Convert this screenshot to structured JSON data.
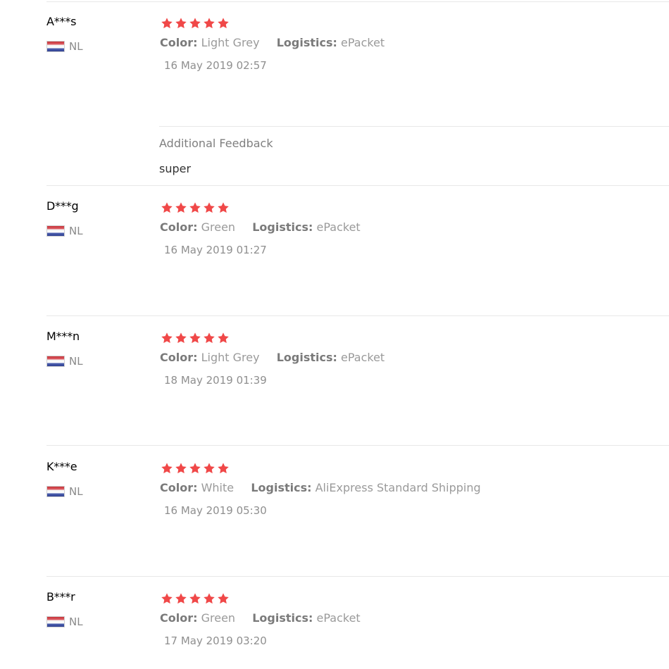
{
  "labels": {
    "color": "Color:",
    "logistics": "Logistics:",
    "additional_feedback": "Additional Feedback"
  },
  "star_color": "#f04848",
  "flag_icon": "netherlands-flag-icon",
  "reviews": [
    {
      "user": "A***s",
      "country": "NL",
      "rating": 5,
      "color": "Light Grey",
      "logistics": "ePacket",
      "date": "16 May 2019 02:57",
      "additional_feedback": "super"
    },
    {
      "user": "D***g",
      "country": "NL",
      "rating": 5,
      "color": "Green",
      "logistics": "ePacket",
      "date": "16 May 2019 01:27"
    },
    {
      "user": "M***n",
      "country": "NL",
      "rating": 5,
      "color": "Light Grey",
      "logistics": "ePacket",
      "date": "18 May 2019 01:39"
    },
    {
      "user": "K***e",
      "country": "NL",
      "rating": 5,
      "color": "White",
      "logistics": "AliExpress Standard Shipping",
      "date": "16 May 2019 05:30"
    },
    {
      "user": "B***r",
      "country": "NL",
      "rating": 5,
      "color": "Green",
      "logistics": "ePacket",
      "date": "17 May 2019 03:20"
    }
  ]
}
